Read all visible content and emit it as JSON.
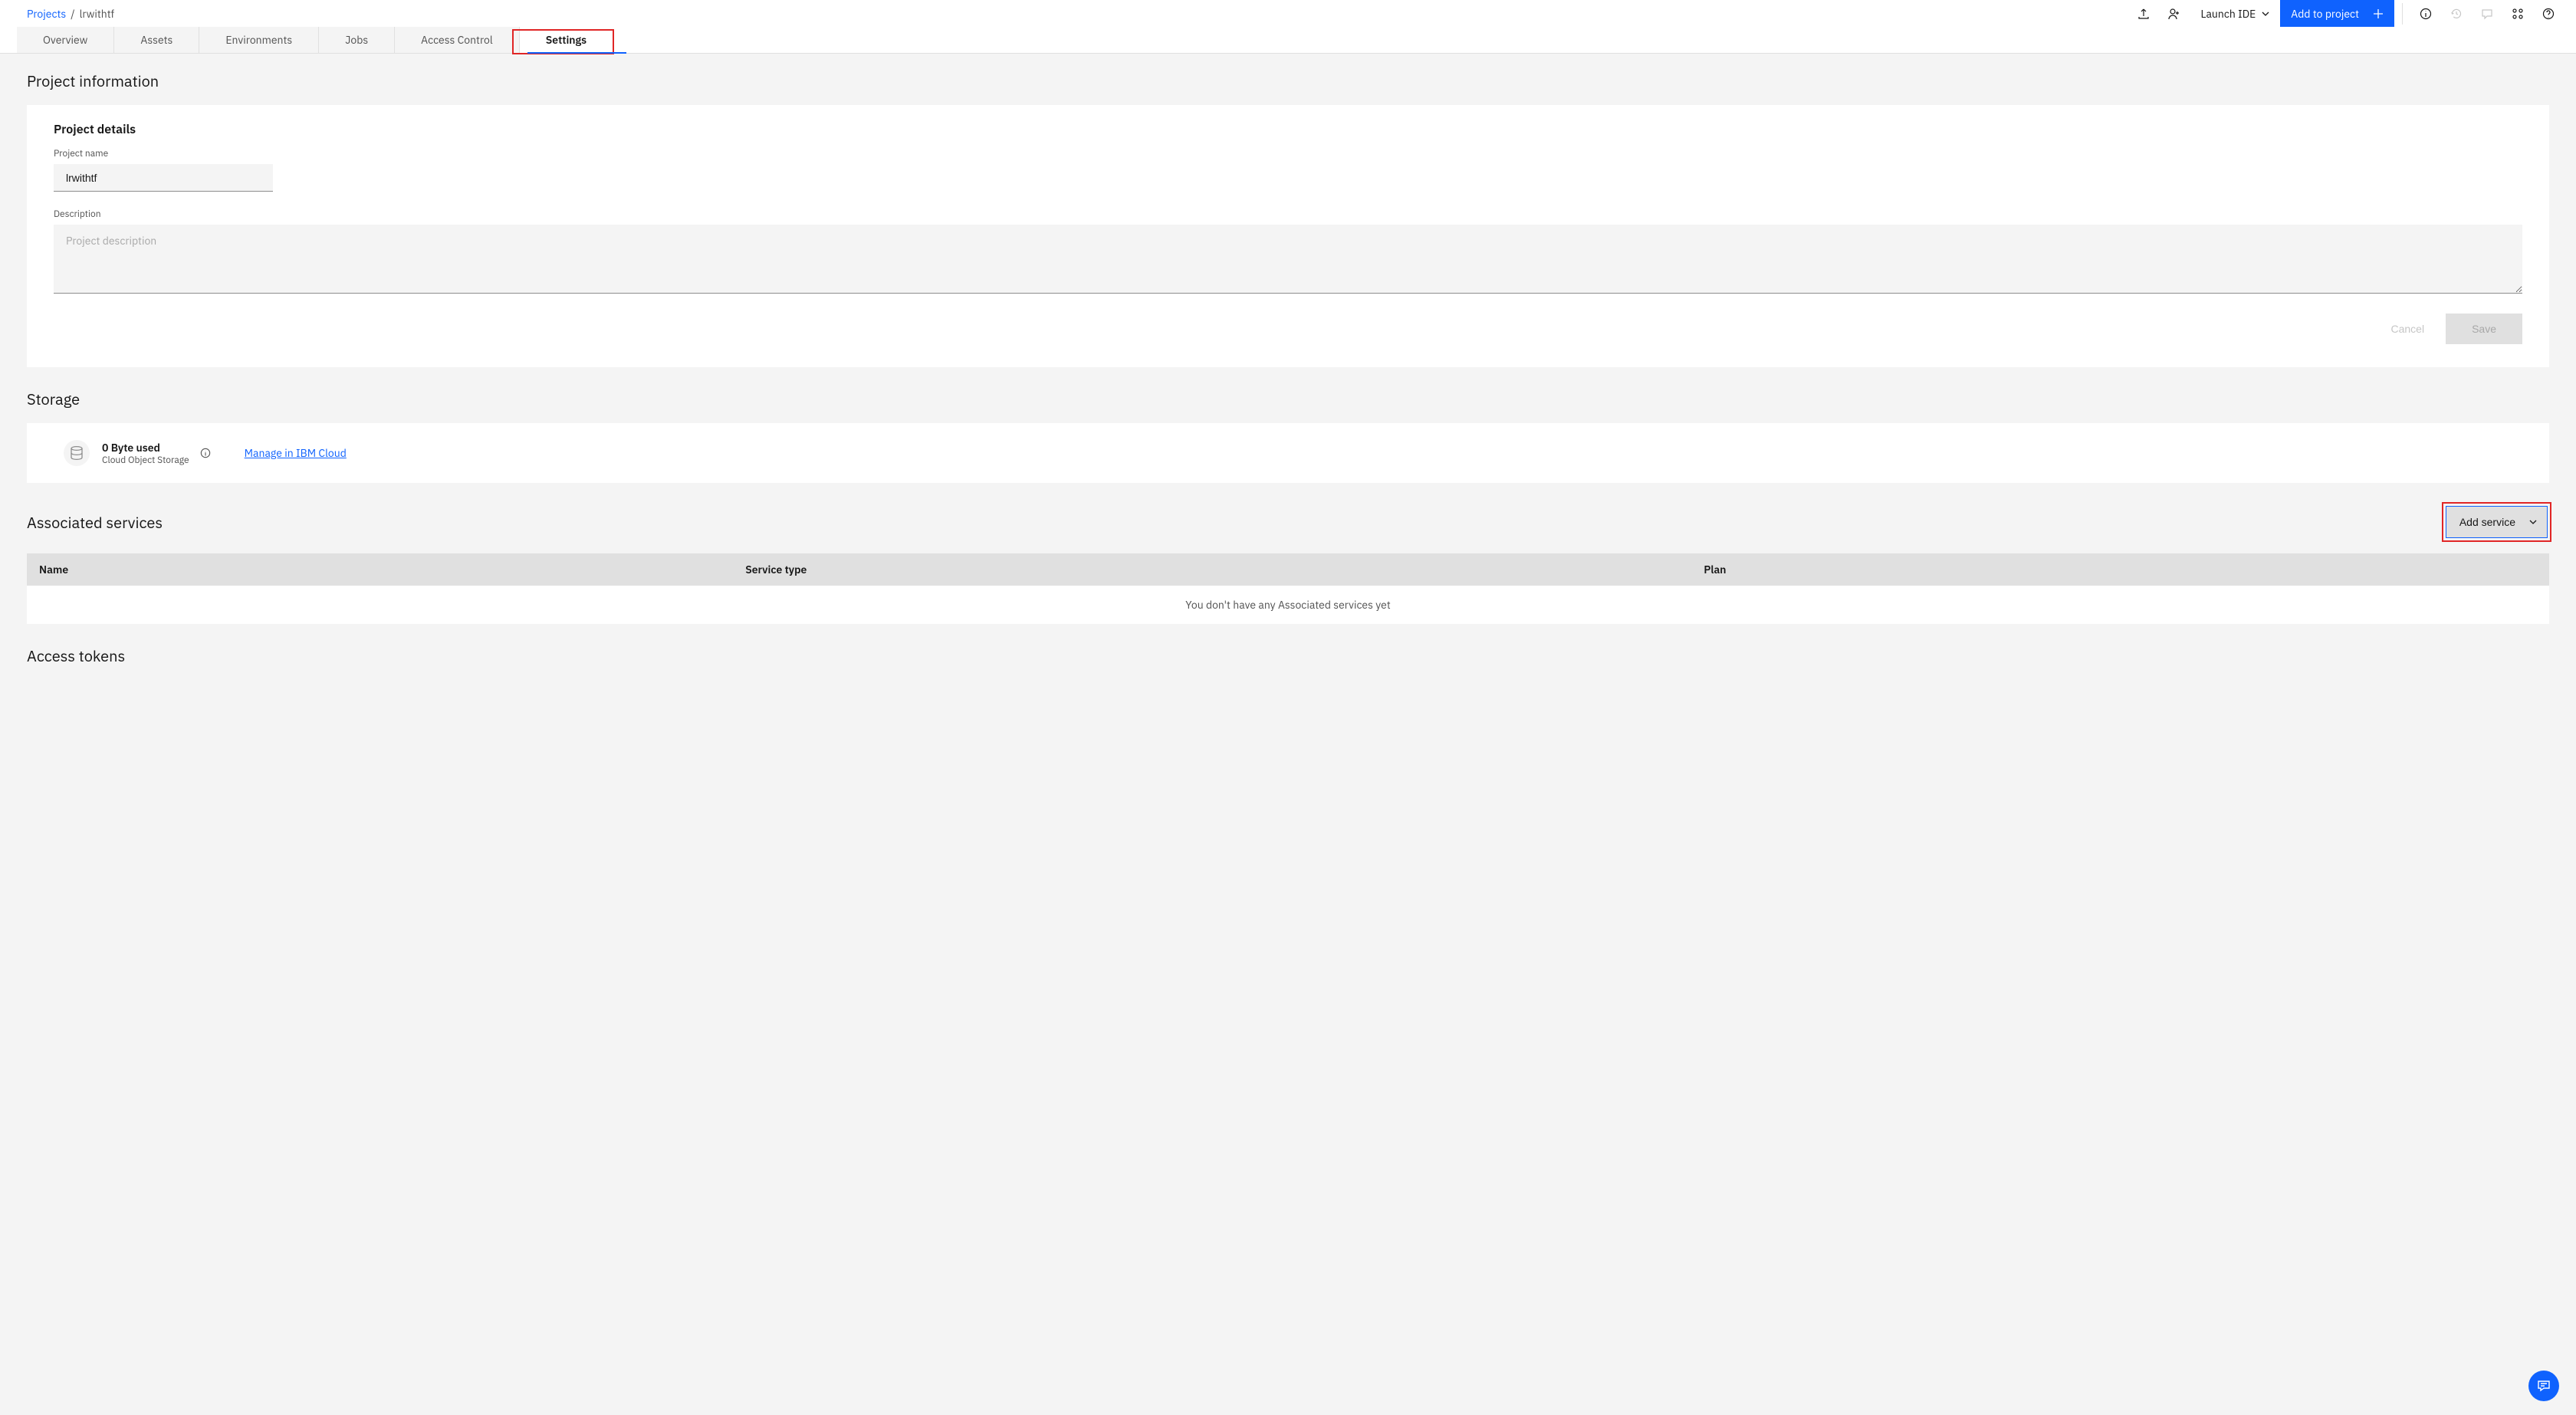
{
  "breadcrumb": {
    "root": "Projects",
    "sep": "/",
    "current": "lrwithtf"
  },
  "header": {
    "launch_ide": "Launch IDE",
    "add_to_project": "Add to project"
  },
  "tabs": {
    "overview": "Overview",
    "assets": "Assets",
    "environments": "Environments",
    "jobs": "Jobs",
    "access_control": "Access Control",
    "settings": "Settings"
  },
  "project_info": {
    "section_title": "Project information",
    "details_title": "Project details",
    "name_label": "Project name",
    "name_value": "lrwithtf",
    "desc_label": "Description",
    "desc_placeholder": "Project description",
    "cancel": "Cancel",
    "save": "Save"
  },
  "storage": {
    "section_title": "Storage",
    "usage": "0 Byte used",
    "service_name": "Cloud Object Storage",
    "manage_link": "Manage in IBM Cloud"
  },
  "assoc": {
    "section_title": "Associated services",
    "add_btn": "Add service",
    "col_name": "Name",
    "col_type": "Service type",
    "col_plan": "Plan",
    "empty": "You don't have any Associated services yet"
  },
  "tokens": {
    "section_title": "Access tokens"
  }
}
